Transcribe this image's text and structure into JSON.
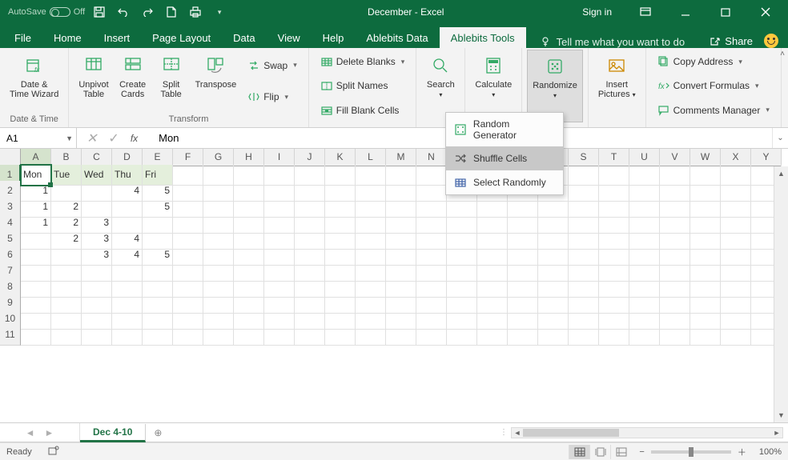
{
  "titlebar": {
    "autosave_label": "AutoSave",
    "autosave_state": "Off",
    "document_title": "December  -  Excel",
    "sign_in": "Sign in"
  },
  "tabs": {
    "file": "File",
    "items": [
      "Home",
      "Insert",
      "Page Layout",
      "Data",
      "View",
      "Help",
      "Ablebits Data",
      "Ablebits Tools"
    ],
    "active_index": 7,
    "tell_me": "Tell me what you want to do",
    "share": "Share"
  },
  "ribbon": {
    "groups": [
      {
        "label": "Date & Time",
        "big": [
          {
            "icon": "calendar-fx",
            "line1": "Date &",
            "line2": "Time Wizard"
          }
        ]
      },
      {
        "label": "Transform",
        "big": [
          {
            "icon": "unpivot",
            "line1": "Unpivot",
            "line2": "Table"
          },
          {
            "icon": "cards",
            "line1": "Create",
            "line2": "Cards"
          },
          {
            "icon": "split-table",
            "line1": "Split",
            "line2": "Table"
          },
          {
            "icon": "transpose",
            "line1": "Transpose",
            "line2": ""
          }
        ],
        "small": [
          {
            "icon": "swap",
            "label": "Swap",
            "drop": true
          },
          {
            "icon": "flip",
            "label": "Flip",
            "drop": true
          }
        ]
      },
      {
        "label": "",
        "small": [
          {
            "icon": "delete-blanks",
            "label": "Delete Blanks",
            "drop": true
          },
          {
            "icon": "split-names",
            "label": "Split Names",
            "drop": false
          },
          {
            "icon": "fill-blank",
            "label": "Fill Blank Cells",
            "drop": false
          }
        ]
      },
      {
        "label": "",
        "big": [
          {
            "icon": "search",
            "line1": "Search",
            "line2": "",
            "drop": true
          }
        ]
      },
      {
        "label": "",
        "big": [
          {
            "icon": "calculate",
            "line1": "Calculate",
            "line2": "",
            "drop": true
          }
        ]
      },
      {
        "label": "",
        "big": [
          {
            "icon": "randomize",
            "line1": "Randomize",
            "line2": "",
            "drop": true,
            "highlighted": true
          }
        ]
      },
      {
        "label": "",
        "big": [
          {
            "icon": "pictures",
            "line1": "Insert",
            "line2": "Pictures",
            "drop": true
          }
        ]
      },
      {
        "label": "",
        "small": [
          {
            "icon": "copy-addr",
            "label": "Copy Address",
            "drop": true
          },
          {
            "icon": "convert",
            "label": "Convert Formulas",
            "drop": true
          },
          {
            "icon": "comments",
            "label": "Comments Manager",
            "drop": true
          }
        ]
      }
    ]
  },
  "dropdown": {
    "items": [
      {
        "icon": "random-gen",
        "label": "Random Generator"
      },
      {
        "icon": "shuffle",
        "label": "Shuffle Cells",
        "hover": true
      },
      {
        "icon": "select-random",
        "label": "Select Randomly"
      }
    ]
  },
  "formula": {
    "name_box": "A1",
    "value": "Mon"
  },
  "grid": {
    "columns": [
      "A",
      "B",
      "C",
      "D",
      "E",
      "F",
      "G",
      "H",
      "I",
      "J",
      "K",
      "L",
      "M",
      "N",
      "O",
      "P",
      "Q",
      "R",
      "S",
      "T",
      "U",
      "V",
      "W",
      "X",
      "Y"
    ],
    "visible_rows": 11,
    "selected": {
      "col": 0,
      "row": 0
    },
    "highlight_row": 0,
    "highlight_cols": 5,
    "data": [
      [
        "Mon",
        "Tue",
        "Wed",
        "Thu",
        "Fri"
      ],
      [
        "1",
        "",
        "",
        "4",
        "5"
      ],
      [
        "1",
        "2",
        "",
        "",
        "5"
      ],
      [
        "1",
        "2",
        "3",
        "",
        ""
      ],
      [
        "",
        "2",
        "3",
        "4",
        ""
      ],
      [
        "",
        "",
        "3",
        "4",
        "5"
      ]
    ]
  },
  "sheet_tabs": {
    "active": "Dec 4-10"
  },
  "statusbar": {
    "ready": "Ready",
    "zoom": "100%"
  }
}
